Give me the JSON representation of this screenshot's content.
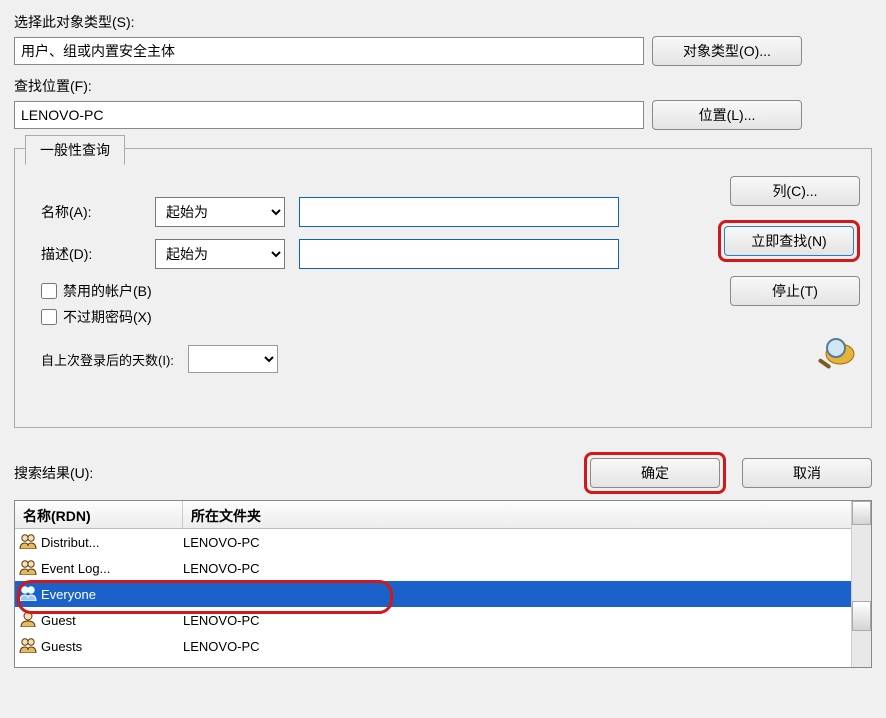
{
  "labels": {
    "object_type": "选择此对象类型(S):",
    "object_type_value": "用户、组或内置安全主体",
    "object_types_btn": "对象类型(O)...",
    "lookup_location": "查找位置(F):",
    "location_value": "LENOVO-PC",
    "locations_btn": "位置(L)...",
    "general_query_tab": "一般性查询",
    "name_label": "名称(A):",
    "desc_label": "描述(D):",
    "starts_with": "起始为",
    "disabled_accounts": "禁用的帐户(B)",
    "non_expiring_pw": "不过期密码(X)",
    "days_since_login": "自上次登录后的天数(I):",
    "columns_btn": "列(C)...",
    "find_now_btn": "立即查找(N)",
    "stop_btn": "停止(T)",
    "ok_btn": "确定",
    "cancel_btn": "取消",
    "search_results": "搜索结果(U):",
    "col_name": "名称(RDN)",
    "col_folder": "所在文件夹"
  },
  "results": [
    {
      "name": "Distribut...",
      "folder": "LENOVO-PC",
      "selected": false,
      "icon": "group"
    },
    {
      "name": "Event Log...",
      "folder": "LENOVO-PC",
      "selected": false,
      "icon": "group"
    },
    {
      "name": "Everyone",
      "folder": "",
      "selected": true,
      "icon": "group"
    },
    {
      "name": "Guest",
      "folder": "LENOVO-PC",
      "selected": false,
      "icon": "user"
    },
    {
      "name": "Guests",
      "folder": "LENOVO-PC",
      "selected": false,
      "icon": "group"
    }
  ]
}
